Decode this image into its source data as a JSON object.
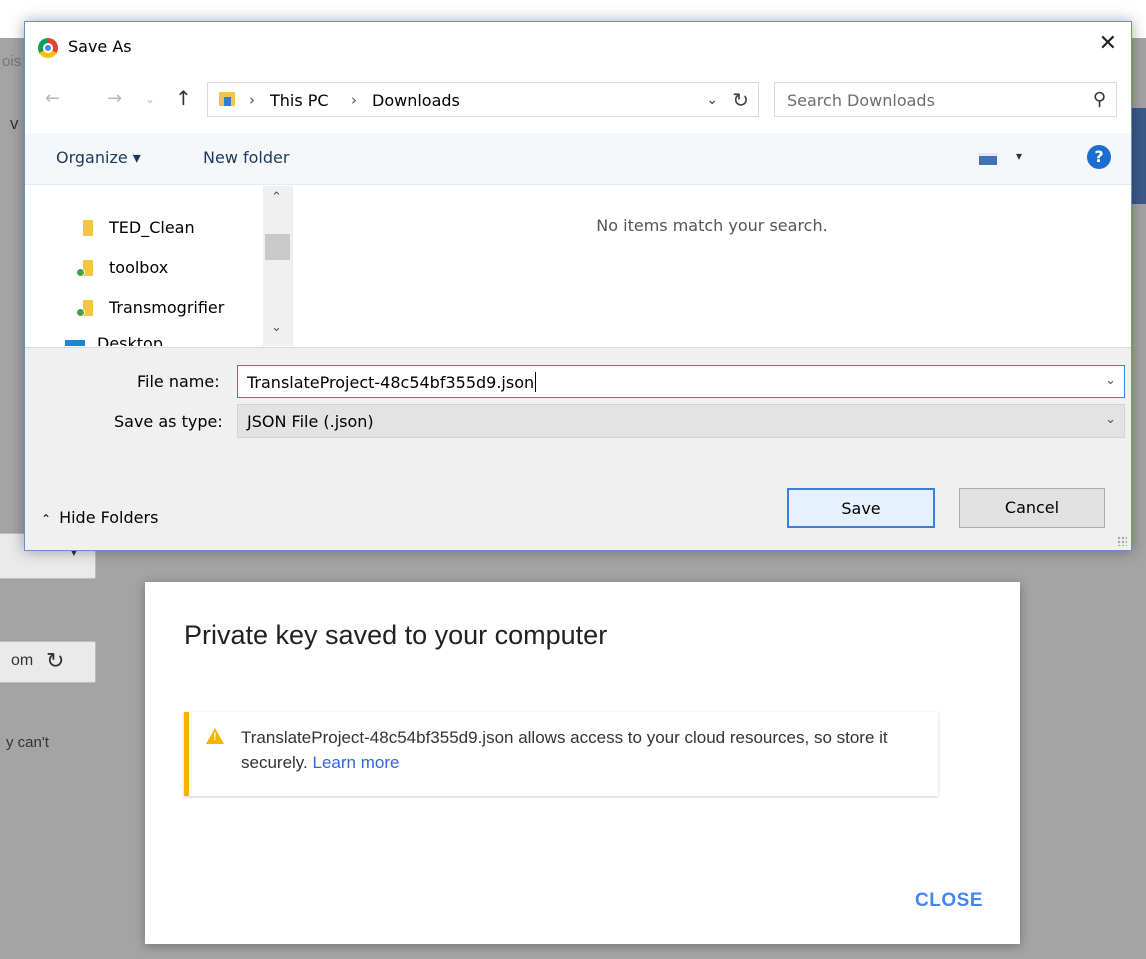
{
  "background": {
    "fragments": [
      "ois",
      "v",
      "om",
      "y can't"
    ]
  },
  "save_dialog": {
    "title": "Save As",
    "close_glyph": "✕",
    "breadcrumb": [
      "This PC",
      "Downloads"
    ],
    "search_placeholder": "Search Downloads",
    "toolbar": {
      "organize": "Organize ▾",
      "new_folder": "New folder",
      "help": "?"
    },
    "tree_items": [
      {
        "label": "TED_Clean",
        "icon": "folder-icon"
      },
      {
        "label": "toolbox",
        "icon": "folder-sync-icon"
      },
      {
        "label": "Transmogrifier",
        "icon": "folder-sync-icon"
      },
      {
        "label": "Desktop",
        "icon": "desktop-icon"
      }
    ],
    "empty_message": "No items match your search.",
    "file_name_label": "File name:",
    "file_name_value": "TranslateProject-48c54bf355d9.json",
    "save_type_label": "Save as type:",
    "save_type_value": "JSON File (.json)",
    "hide_folders": "Hide Folders",
    "save_button": "Save",
    "cancel_button": "Cancel",
    "accent_color": "#3c7fdc"
  },
  "key_modal": {
    "title": "Private key saved to your computer",
    "warning_text": "TranslateProject-48c54bf355d9.json allows access to your cloud resources, so store it securely.",
    "learn_more": "Learn more",
    "close_label": "CLOSE",
    "warning_color": "#f4b400",
    "link_color": "#4285f4"
  }
}
